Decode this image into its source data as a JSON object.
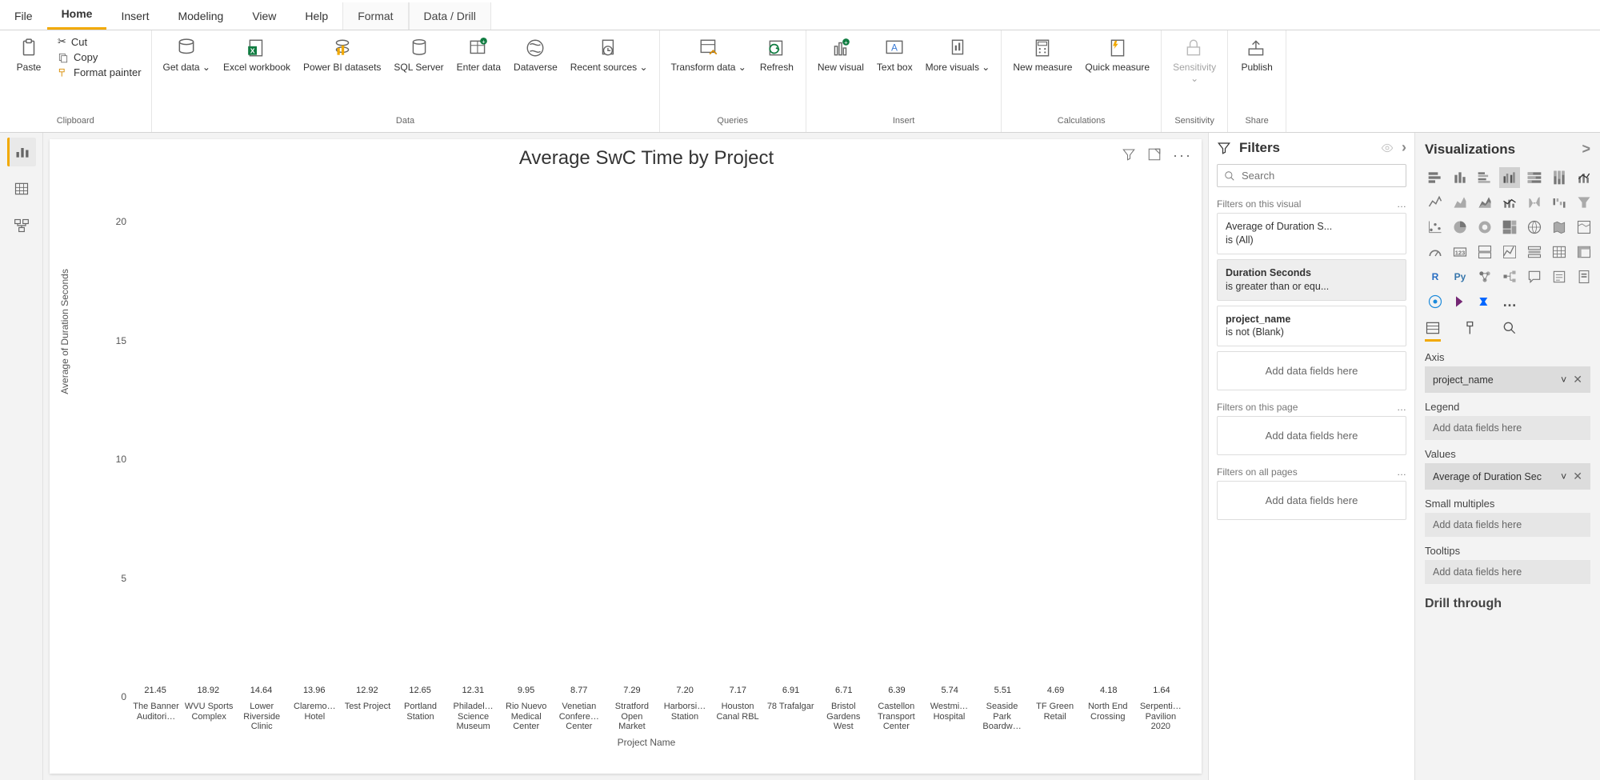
{
  "tabs": {
    "file": "File",
    "home": "Home",
    "insert": "Insert",
    "modeling": "Modeling",
    "view": "View",
    "help": "Help",
    "format": "Format",
    "datadrill": "Data / Drill"
  },
  "ribbon": {
    "paste": "Paste",
    "cut": "Cut",
    "copy": "Copy",
    "format_painter": "Format painter",
    "clipboard": "Clipboard",
    "get_data": "Get data",
    "excel_workbook": "Excel workbook",
    "powerbi_datasets": "Power BI datasets",
    "sql_server": "SQL Server",
    "enter_data": "Enter data",
    "dataverse": "Dataverse",
    "recent_sources": "Recent sources",
    "data_group": "Data",
    "transform_data": "Transform data",
    "refresh": "Refresh",
    "queries": "Queries",
    "new_visual": "New visual",
    "text_box": "Text box",
    "more_visuals": "More visuals",
    "insert_group": "Insert",
    "new_measure": "New measure",
    "quick_measure": "Quick measure",
    "calculations": "Calculations",
    "sensitivity": "Sensitivity",
    "sensitivity_group": "Sensitivity",
    "publish": "Publish",
    "share": "Share",
    "caret": "⌄"
  },
  "chart": {
    "title": "Average SwC Time by Project",
    "y_label": "Average of Duration Seconds",
    "x_label": "Project Name",
    "y_ticks": [
      "0",
      "5",
      "10",
      "15",
      "20"
    ]
  },
  "filters": {
    "title": "Filters",
    "search_placeholder": "Search",
    "on_visual": "Filters on this visual",
    "f1_line1": "Average of Duration S...",
    "f1_line2": "is (All)",
    "f2_line1": "Duration Seconds",
    "f2_line2": "is greater than or equ...",
    "f3_line1": "project_name",
    "f3_line2": "is not (Blank)",
    "drop": "Add data fields here",
    "on_page": "Filters on this page",
    "on_all": "Filters on all pages",
    "dots": "…"
  },
  "viz": {
    "title": "Visualizations",
    "axis": "Axis",
    "axis_val": "project_name",
    "legend": "Legend",
    "legend_ph": "Add data fields here",
    "values": "Values",
    "values_val": "Average of Duration Sec",
    "small_multiples": "Small multiples",
    "small_multiples_ph": "Add data fields here",
    "tooltips": "Tooltips",
    "tooltips_ph": "Add data fields here",
    "drill_through": "Drill through",
    "r_label": "R",
    "py_label": "Py",
    "chevron": ">",
    "more": "…"
  },
  "chart_data": {
    "type": "bar",
    "title": "Average SwC Time by Project",
    "xlabel": "Project Name",
    "ylabel": "Average of Duration Seconds",
    "ylim": [
      0,
      22
    ],
    "categories": [
      "The Banner Auditori…",
      "WVU Sports Complex",
      "Lower Riverside Clinic",
      "Claremo… Hotel",
      "Test Project",
      "Portland Station",
      "Philadel… Science Museum",
      "Rio Nuevo Medical Center",
      "Venetian Confere… Center",
      "Stratford Open Market",
      "Harborsi… Station",
      "Houston Canal RBL",
      "78 Trafalgar",
      "Bristol Gardens West",
      "Castellon Transport Center",
      "Westmi… Hospital",
      "Seaside Park Boardw…",
      "TF Green Retail",
      "North End Crossing",
      "Serpenti… Pavilion 2020"
    ],
    "values": [
      21.45,
      18.92,
      14.64,
      13.96,
      12.92,
      12.65,
      12.31,
      9.95,
      8.77,
      7.29,
      7.2,
      7.17,
      6.91,
      6.71,
      6.39,
      5.74,
      5.51,
      4.69,
      4.18,
      1.64
    ]
  }
}
